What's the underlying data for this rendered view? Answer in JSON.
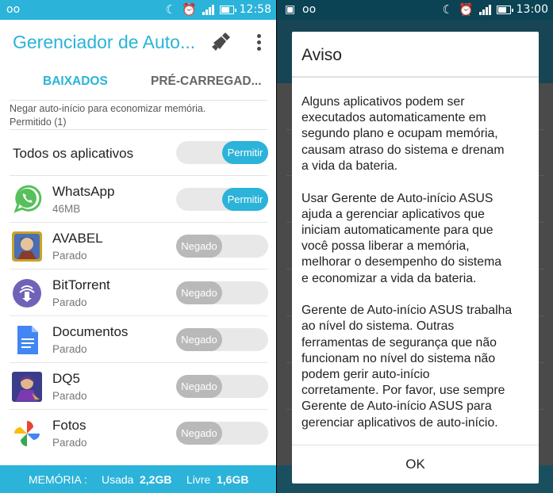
{
  "left": {
    "status": {
      "carrier": "oo",
      "time": "12:58"
    },
    "app_title": "Gerenciador de Auto...",
    "tabs": [
      {
        "label": "BAIXADOS"
      },
      {
        "label": "PRÉ-CARREGAD..."
      }
    ],
    "note_line1": "Negar auto-início para economizar memória.",
    "note_line2": "Permitido (1)",
    "all_apps": {
      "label": "Todos os aplicativos",
      "toggle": "Permitir"
    },
    "apps": [
      {
        "name": "WhatsApp",
        "sub": "46MB",
        "toggle": "Permitir",
        "icon": "whatsapp-icon"
      },
      {
        "name": "AVABEL",
        "sub": "Parado",
        "toggle": "Negado",
        "icon": "avabel-icon"
      },
      {
        "name": "BitTorrent",
        "sub": "Parado",
        "toggle": "Negado",
        "icon": "bittorrent-icon"
      },
      {
        "name": "Documentos",
        "sub": "Parado",
        "toggle": "Negado",
        "icon": "docs-icon"
      },
      {
        "name": "DQ5",
        "sub": "Parado",
        "toggle": "Negado",
        "icon": "dq5-icon"
      },
      {
        "name": "Fotos",
        "sub": "Parado",
        "toggle": "Negado",
        "icon": "photos-icon"
      }
    ],
    "footer": {
      "memory_label": "MEMÓRIA :",
      "used_label": "Usada",
      "used_value": "2,2GB",
      "free_label": "Livre",
      "free_value": "1,6GB"
    },
    "colors": {
      "accent": "#2bb3d9"
    }
  },
  "right": {
    "status": {
      "carrier": "oo",
      "time": "13:00"
    },
    "dialog": {
      "title": "Aviso",
      "paragraphs": [
        "Alguns aplicativos podem ser\nexecutados automaticamente em\nsegundo plano e ocupam memória,\ncausam atraso do sistema e drenam\na vida da bateria.",
        "Usar Gerente de Auto-início ASUS\najuda a gerenciar aplicativos que\niniciam automaticamente para que\nvocê possa liberar a memória,\nmelhorar o desempenho do sistema\ne economizar a vida da bateria.",
        "Gerente de Auto-início ASUS trabalha\nao nível do sistema. Outras\nferramentas de segurança que não\nfuncionam no nível do sistema não\npodem gerir auto-início\ncorretamente. Por favor, use sempre\nGerente de Auto-início ASUS para\ngerenciar aplicativos de auto-início."
      ],
      "ok_label": "OK"
    }
  }
}
